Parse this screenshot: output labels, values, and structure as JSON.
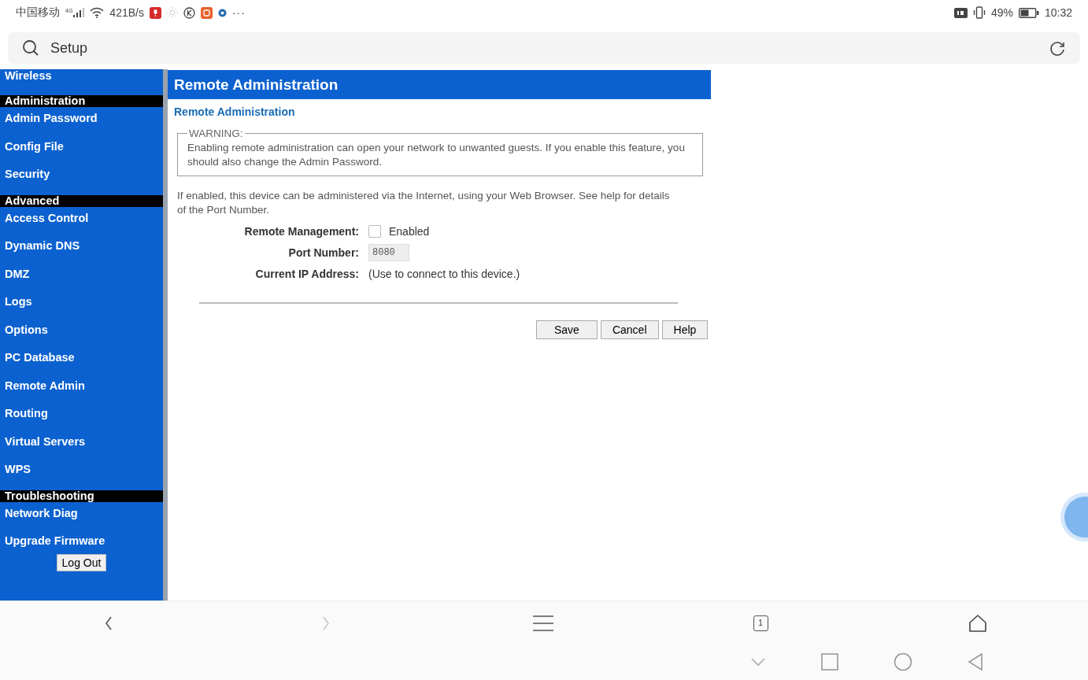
{
  "status_bar": {
    "carrier": "中国移动",
    "network_type": "4G",
    "speed": "421B/s",
    "more": "···",
    "battery_percent": "49%",
    "time": "10:32"
  },
  "address_bar": {
    "value": "Setup"
  },
  "sidebar": {
    "items": [
      {
        "kind": "link",
        "label": "Wireless"
      },
      {
        "kind": "heading",
        "label": "Administration"
      },
      {
        "kind": "link",
        "label": "Admin Password"
      },
      {
        "kind": "link",
        "label": "Config File"
      },
      {
        "kind": "link",
        "label": "Security"
      },
      {
        "kind": "heading",
        "label": "Advanced"
      },
      {
        "kind": "link",
        "label": "Access Control"
      },
      {
        "kind": "link",
        "label": "Dynamic DNS"
      },
      {
        "kind": "link",
        "label": "DMZ"
      },
      {
        "kind": "link",
        "label": "Logs"
      },
      {
        "kind": "link",
        "label": "Options"
      },
      {
        "kind": "link",
        "label": "PC Database"
      },
      {
        "kind": "link",
        "label": "Remote Admin"
      },
      {
        "kind": "link",
        "label": "Routing"
      },
      {
        "kind": "link",
        "label": "Virtual Servers"
      },
      {
        "kind": "link",
        "label": "WPS"
      },
      {
        "kind": "heading",
        "label": "Troubleshooting"
      },
      {
        "kind": "link",
        "label": "Network Diag"
      },
      {
        "kind": "link",
        "label": "Upgrade Firmware"
      }
    ],
    "logout_button": "Log Out"
  },
  "content": {
    "title": "Remote Administration",
    "subtitle": "Remote Administration",
    "warning": {
      "legend": "WARNING:",
      "text": "Enabling remote administration can open your network to unwanted guests. If you enable this feature, you should also change the Admin Password."
    },
    "intro": "If enabled, this device can be administered via the Internet, using your Web Browser. See help for details of the Port Number.",
    "fields": [
      {
        "kind": "checkbox",
        "label": "Remote Management:",
        "option": "Enabled",
        "checked": false
      },
      {
        "kind": "input",
        "label": "Port Number:",
        "value": "8080",
        "disabled": true
      },
      {
        "kind": "text",
        "label": "Current IP Address:",
        "value": "(Use to connect to this device.)"
      }
    ],
    "buttons": [
      "Save",
      "Cancel",
      "Help"
    ]
  },
  "browser_toolbar": {
    "back_disabled": false,
    "forward_disabled": true,
    "tab_count": "1"
  }
}
